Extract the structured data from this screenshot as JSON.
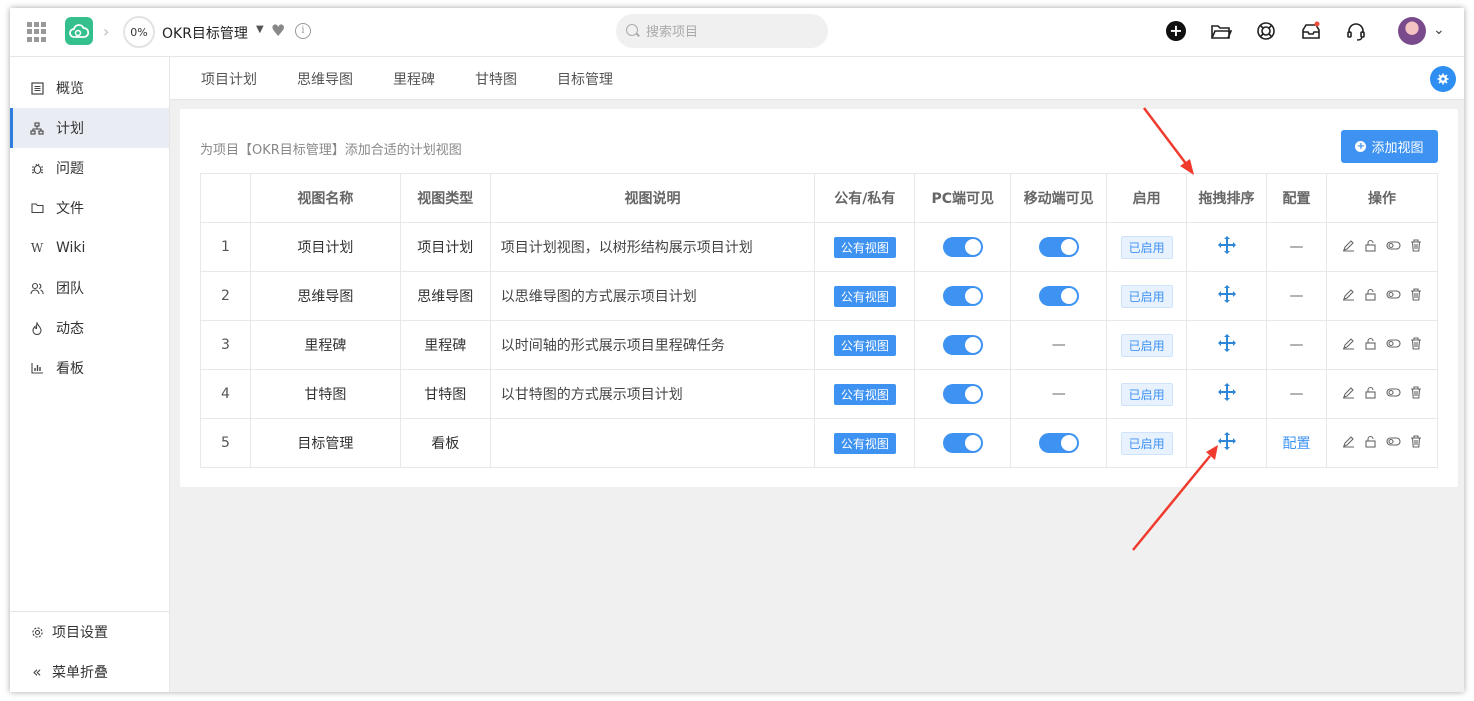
{
  "header": {
    "progress": "0%",
    "project_name": "OKR目标管理",
    "search_placeholder": "搜索项目"
  },
  "sidebar": {
    "items": [
      {
        "label": "概览",
        "icon": "overview-icon"
      },
      {
        "label": "计划",
        "icon": "plan-icon",
        "active": true
      },
      {
        "label": "问题",
        "icon": "bug-icon"
      },
      {
        "label": "文件",
        "icon": "folder-icon"
      },
      {
        "label": "Wiki",
        "icon": "wiki-icon"
      },
      {
        "label": "团队",
        "icon": "team-icon"
      },
      {
        "label": "动态",
        "icon": "activity-icon"
      },
      {
        "label": "看板",
        "icon": "board-icon"
      }
    ],
    "bottom": [
      {
        "label": "项目设置",
        "icon": "gear-icon"
      },
      {
        "label": "菜单折叠",
        "icon": "collapse-icon"
      }
    ]
  },
  "tabs": [
    "项目计划",
    "思维导图",
    "里程碑",
    "甘特图",
    "目标管理"
  ],
  "card": {
    "description": "为项目【OKR目标管理】添加合适的计划视图",
    "add_button": "添加视图"
  },
  "table": {
    "headers": [
      "",
      "视图名称",
      "视图类型",
      "视图说明",
      "公有/私有",
      "PC端可见",
      "移动端可见",
      "启用",
      "拖拽排序",
      "配置",
      "操作"
    ],
    "rows": [
      {
        "index": "1",
        "name": "项目计划",
        "type": "项目计划",
        "desc": "项目计划视图，以树形结构展示项目计划",
        "visibility": "公有视图",
        "pc": true,
        "mobile": true,
        "enabled": "已启用",
        "config": "—"
      },
      {
        "index": "2",
        "name": "思维导图",
        "type": "思维导图",
        "desc": "以思维导图的方式展示项目计划",
        "visibility": "公有视图",
        "pc": true,
        "mobile": true,
        "enabled": "已启用",
        "config": "—"
      },
      {
        "index": "3",
        "name": "里程碑",
        "type": "里程碑",
        "desc": "以时间轴的形式展示项目里程碑任务",
        "visibility": "公有视图",
        "pc": true,
        "mobile": false,
        "mobile_text": "—",
        "enabled": "已启用",
        "config": "—"
      },
      {
        "index": "4",
        "name": "甘特图",
        "type": "甘特图",
        "desc": "以甘特图的方式展示项目计划",
        "visibility": "公有视图",
        "pc": true,
        "mobile": false,
        "mobile_text": "—",
        "enabled": "已启用",
        "config": "—"
      },
      {
        "index": "5",
        "name": "目标管理",
        "type": "看板",
        "desc": "",
        "visibility": "公有视图",
        "pc": true,
        "mobile": true,
        "enabled": "已启用",
        "config": "配置"
      }
    ]
  },
  "colors": {
    "accent": "#3e92f2",
    "annotation_arrow": "#f03a2e",
    "logo": "#33c08d"
  }
}
